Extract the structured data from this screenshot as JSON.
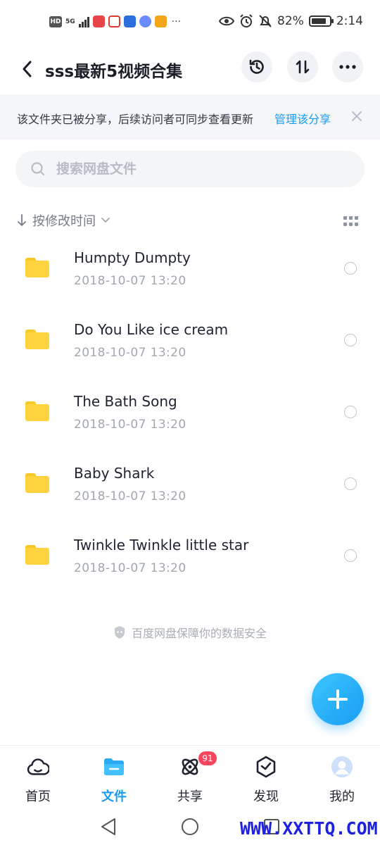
{
  "status_bar": {
    "hd": "HD",
    "network": "5G",
    "battery": "82%",
    "battery_level": 0.82,
    "time": "2:14",
    "more": "···"
  },
  "header": {
    "title": "sss最新5视频合集",
    "icons": [
      "back-icon",
      "history-icon",
      "transfer-icon",
      "more-icon"
    ]
  },
  "share_notice": {
    "text": "该文件夹已被分享，后续访问者可同步查看更新",
    "link": "管理该分享"
  },
  "search": {
    "placeholder": "搜索网盘文件"
  },
  "sort": {
    "label": "按修改时间"
  },
  "files": [
    {
      "name": "Humpty Dumpty",
      "date": "2018-10-07  13:20"
    },
    {
      "name": "Do You Like ice cream",
      "date": "2018-10-07  13:20"
    },
    {
      "name": "The Bath Song",
      "date": "2018-10-07  13:20"
    },
    {
      "name": "Baby Shark",
      "date": "2018-10-07  13:20"
    },
    {
      "name": "Twinkle Twinkle little star",
      "date": "2018-10-07  13:20"
    }
  ],
  "security_note": "百度网盘保障你的数据安全",
  "tabs": [
    {
      "label": "首页",
      "icon": "cloud-home-icon"
    },
    {
      "label": "文件",
      "icon": "folder-icon"
    },
    {
      "label": "共享",
      "icon": "atom-share-icon",
      "badge": "91"
    },
    {
      "label": "发现",
      "icon": "cube-discover-icon"
    },
    {
      "label": "我的",
      "icon": "avatar-icon"
    }
  ],
  "colors": {
    "accent": "#1a9bf0",
    "folder": "#ffd33d",
    "badge": "#f5455f"
  },
  "watermark": "WWW.XXTTQ.COM"
}
